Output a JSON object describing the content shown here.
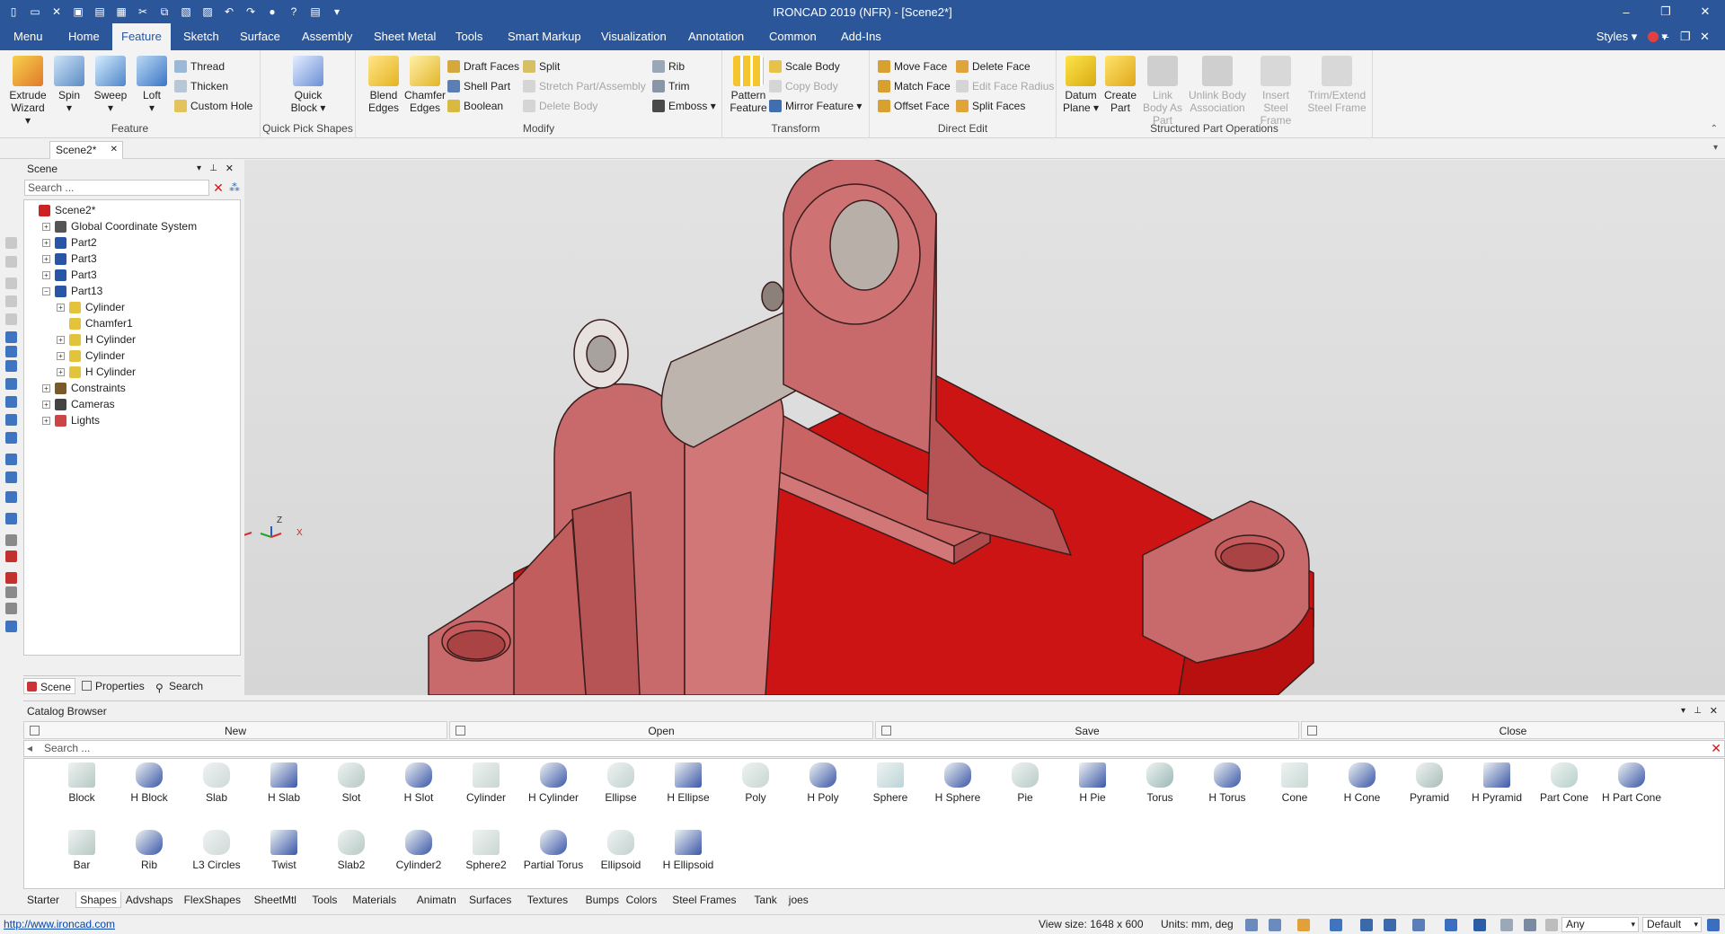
{
  "window": {
    "title": "IRONCAD 2019 (NFR) - [Scene2*]",
    "controls": [
      "–",
      "❐",
      "✕"
    ]
  },
  "quick_access": [
    "new-icon",
    "open-icon",
    "close-icon",
    "save-all-icon",
    "save-icon",
    "print-icon",
    "cut-icon",
    "copy-icon",
    "paste-icon",
    "image-icon",
    "undo-icon",
    "redo-icon",
    "render-icon",
    "help-icon",
    "window-icon",
    "more-icon"
  ],
  "menu_tabs": [
    "Menu",
    "Home",
    "Feature",
    "Sketch",
    "Surface",
    "Assembly",
    "Sheet Metal",
    "Tools",
    "Smart Markup",
    "Visualization",
    "Annotation",
    "Common",
    "Add-Ins"
  ],
  "active_tab": "Feature",
  "menu_right": {
    "styles": "Styles",
    "inner_controls": [
      "–",
      "❐",
      "✕"
    ]
  },
  "ribbon": {
    "feature": {
      "label": "Feature",
      "big": [
        "Extrude Wizard",
        "Spin",
        "Sweep",
        "Loft"
      ],
      "small": [
        "Thread",
        "Thicken",
        "Custom Hole"
      ]
    },
    "quick_pick": {
      "label": "Quick Pick Shapes",
      "big": [
        "Quick Block"
      ]
    },
    "modify": {
      "label": "Modify",
      "big": [
        "Blend Edges",
        "Chamfer Edges"
      ],
      "col1": [
        "Draft Faces",
        "Shell Part",
        "Boolean"
      ],
      "col2": [
        "Split",
        "Stretch Part/Assembly",
        "Delete Body"
      ],
      "col3": [
        "Rib",
        "Trim",
        "Emboss"
      ]
    },
    "transform": {
      "label": "Transform",
      "big": [
        "Pattern Feature"
      ],
      "small": [
        "Scale Body",
        "Copy Body",
        "Mirror Feature"
      ]
    },
    "direct_edit": {
      "label": "Direct Edit",
      "col1": [
        "Move Face",
        "Match Face",
        "Offset Face"
      ],
      "col2": [
        "Delete Face",
        "Edit Face Radius",
        "Split Faces"
      ]
    },
    "structured": {
      "label": "Structured Part Operations",
      "big": [
        "Datum Plane",
        "Create Part",
        "Link Body As Part",
        "Unlink Body Association",
        "Insert Steel Frame",
        "Trim/Extend Steel Frame"
      ]
    }
  },
  "doc_tab": {
    "name": "Scene2*",
    "close": "✕"
  },
  "scene": {
    "header": "Scene",
    "search_placeholder": "Search ...",
    "tree": [
      {
        "label": "Scene2*",
        "level": 0,
        "expander": ""
      },
      {
        "label": "Global Coordinate System",
        "level": 1,
        "expander": "+"
      },
      {
        "label": "Part2",
        "level": 1,
        "expander": "+"
      },
      {
        "label": "Part3",
        "level": 1,
        "expander": "+"
      },
      {
        "label": "Part3",
        "level": 1,
        "expander": "+"
      },
      {
        "label": "Part13",
        "level": 1,
        "expander": "−"
      },
      {
        "label": "Cylinder",
        "level": 2,
        "expander": "+"
      },
      {
        "label": "Chamfer1",
        "level": 2,
        "expander": ""
      },
      {
        "label": "H Cylinder",
        "level": 2,
        "expander": "+"
      },
      {
        "label": "Cylinder",
        "level": 2,
        "expander": "+"
      },
      {
        "label": "H Cylinder",
        "level": 2,
        "expander": "+"
      },
      {
        "label": "Constraints",
        "level": 1,
        "expander": "+"
      },
      {
        "label": "Cameras",
        "level": 1,
        "expander": "+"
      },
      {
        "label": "Lights",
        "level": 1,
        "expander": "+"
      }
    ],
    "tabs": [
      "Scene",
      "Properties",
      "Search"
    ]
  },
  "axes": {
    "z": "Z",
    "x": "X"
  },
  "colors": {
    "title_bar": "#2b579a",
    "part_face": "#c65f60",
    "base_red": "#cc1414",
    "pin": "#bdb5ad"
  },
  "catalog": {
    "header": "Catalog Browser",
    "commands": [
      "New",
      "Open",
      "Save",
      "Close"
    ],
    "search_placeholder": "Search ...",
    "items_row1": [
      "Block",
      "H Block",
      "Slab",
      "H Slab",
      "Slot",
      "H Slot",
      "Cylinder",
      "H Cylinder",
      "Ellipse",
      "H Ellipse",
      "Poly",
      "H Poly",
      "Sphere",
      "H Sphere",
      "Pie",
      "H Pie",
      "Torus",
      "H Torus",
      "Cone",
      "H Cone",
      "Pyramid",
      "H Pyramid",
      "Part Cone",
      "H Part Cone"
    ],
    "items_row2": [
      "Bar",
      "Rib",
      "L3 Circles",
      "Twist",
      "Slab2",
      "Cylinder2",
      "Sphere2",
      "Partial Torus",
      "Ellipsoid",
      "H Ellipsoid"
    ],
    "tabs": [
      "Starter",
      "Shapes",
      "Advshaps",
      "FlexShapes",
      "SheetMtl",
      "Tools",
      "Materials",
      "Animatn",
      "Surfaces",
      "Textures",
      "Bumps",
      "Colors",
      "Steel Frames",
      "Tank",
      "joes"
    ],
    "active_tab": "Shapes"
  },
  "status": {
    "url": "http://www.ironcad.com",
    "view_size": "View size: 1648 x 600",
    "units": "Units: mm, deg",
    "filter": "Any",
    "mode": "Default"
  }
}
